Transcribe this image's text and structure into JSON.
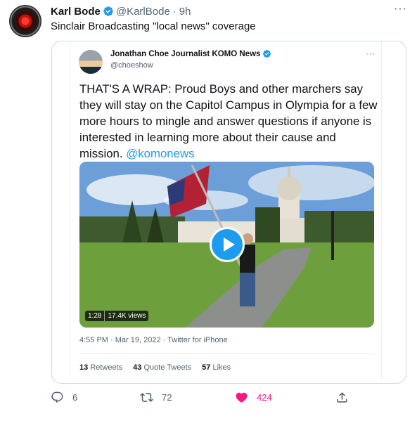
{
  "tweet": {
    "display_name": "Karl Bode",
    "handle": "@KarlBode",
    "separator": "·",
    "timestamp": "9h",
    "more": "···",
    "text": "Sinclair Broadcasting \"local news\" coverage",
    "verified_color": "#1d9bf0",
    "avatar_icon": "hal-9000-eye-icon"
  },
  "quoted": {
    "display_name": "Jonathan Choe Journalist KOMO News",
    "handle": "@choeshow",
    "more": "···",
    "text": "THAT'S A WRAP: Proud Boys and other marchers say they will stay on the Capitol Campus in Olympia for a few more hours to mingle and answer questions if anyone is interested in learning more about their cause and mission.",
    "mention": "@komonews",
    "video": {
      "duration": "1:28",
      "views": "17.4K views",
      "play_icon": "play-icon"
    },
    "meta": "4:55 PM · Mar 19, 2022 · Twitter for iPhone",
    "stats": {
      "retweets_count": "13",
      "retweets_label": "Retweets",
      "quotes_count": "43",
      "quotes_label": "Quote Tweets",
      "likes_count": "57",
      "likes_label": "Likes"
    }
  },
  "actions": {
    "reply_count": "6",
    "retweet_count": "72",
    "like_count": "424",
    "like_color": "#f91880",
    "reply_icon": "reply-icon",
    "retweet_icon": "retweet-icon",
    "like_icon": "heart-icon",
    "share_icon": "share-icon"
  },
  "colors": {
    "accent": "#1d9bf0",
    "text": "#0f1419",
    "secondary": "#536471",
    "border": "#cfd9de"
  }
}
